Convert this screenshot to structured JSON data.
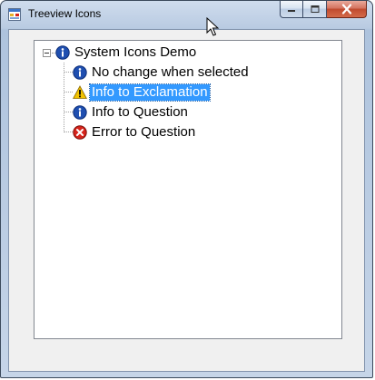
{
  "window": {
    "title": "Treeview Icons",
    "icons": {
      "app": "app-window-icon",
      "minimize": "minimize-icon",
      "maximize": "maximize-icon",
      "close": "close-icon"
    }
  },
  "tree": {
    "root": {
      "label": "System Icons Demo",
      "icon": "info-icon",
      "expanded": true
    },
    "children": [
      {
        "label": "No change when selected",
        "icon": "info-icon",
        "selected": false
      },
      {
        "label": "Info to Exclamation",
        "icon": "warning-icon",
        "selected": true
      },
      {
        "label": "Info to Question",
        "icon": "info-icon",
        "selected": false
      },
      {
        "label": "Error to Question",
        "icon": "error-icon",
        "selected": false
      }
    ]
  },
  "colors": {
    "selection": "#3399ff",
    "info": "#1f4fb0",
    "warning": "#f2c200",
    "error": "#d6241c"
  }
}
